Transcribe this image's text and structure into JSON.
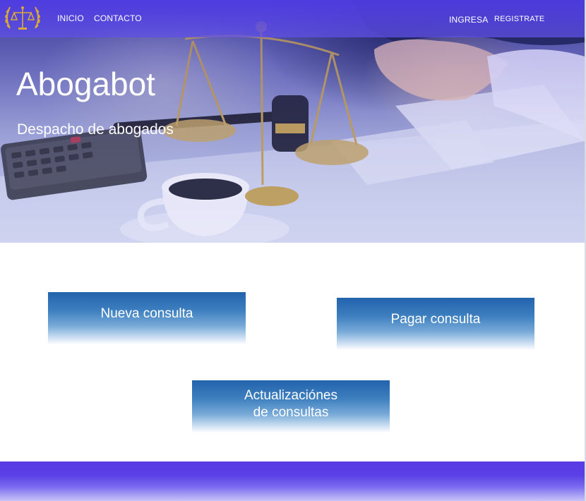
{
  "nav": {
    "left_links": [
      "INICIO",
      "CONTACTO"
    ],
    "login": "INGRESA",
    "register": "REGISTRATE"
  },
  "hero": {
    "title": "Abogabot",
    "subtitle": "Despacho de abogados"
  },
  "actions": {
    "new_consultation": "Nueva consulta",
    "pay_consultation": "Pagar consulta",
    "updates": "Actualizaciónes\nde consultas"
  },
  "colors": {
    "navbar": "#4f3be3",
    "button_top": "#2363ad",
    "footer": "#5a3be3"
  },
  "icons": {
    "logo": "scales-of-justice-laurel-icon"
  }
}
